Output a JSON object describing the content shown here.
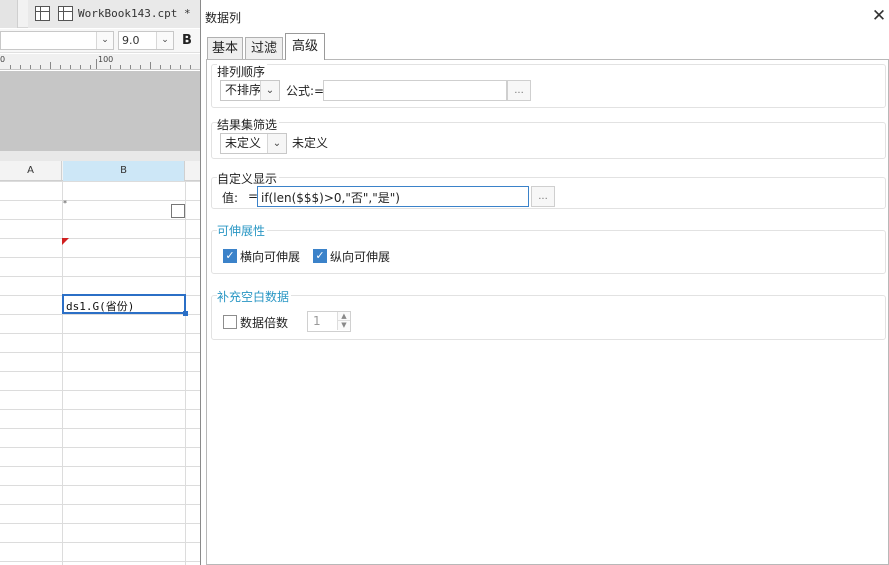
{
  "workbook_tab": {
    "title": "WorkBook143.cpt *"
  },
  "format_bar": {
    "font_size": "9.0",
    "bold_label": "B"
  },
  "ruler": {
    "label": "100",
    "zero": "0"
  },
  "sheet": {
    "columns": [
      "A",
      "B"
    ],
    "selected_cell_text": "ds1.G(省份)",
    "star_mark": "*"
  },
  "dialog": {
    "title": "数据列",
    "close": "✕",
    "tabs": [
      {
        "label": "基本",
        "active": false
      },
      {
        "label": "过滤",
        "active": false
      },
      {
        "label": "高级",
        "active": true
      }
    ],
    "sort": {
      "title": "排列顺序",
      "select_value": "不排序",
      "formula_label": "公式:=",
      "formula_value": "",
      "dots": "..."
    },
    "result_filter": {
      "title": "结果集筛选",
      "select_value": "未定义",
      "value_text": "未定义"
    },
    "custom_display": {
      "title": "自定义显示",
      "value_label": "值:",
      "eq_label": "=",
      "formula_value": "if(len($$$)>0,\"否\",\"是\")",
      "dots": "..."
    },
    "expand": {
      "title": "可伸展性",
      "horizontal_label": "横向可伸展",
      "horizontal_checked": true,
      "vertical_label": "纵向可伸展",
      "vertical_checked": true
    },
    "fill_blank": {
      "title": "补充空白数据",
      "multiple_label": "数据倍数",
      "multiple_checked": false,
      "multiple_value": "1",
      "check_mark": "✓",
      "spin_up": "▲",
      "spin_down": "▼",
      "dropdown_arrow": "⌄"
    }
  },
  "colors": {
    "accent": "#2a97c4",
    "focus_border": "#3b82c9",
    "selection": "#2b6fc6",
    "column_highlight": "#cde7f7"
  }
}
